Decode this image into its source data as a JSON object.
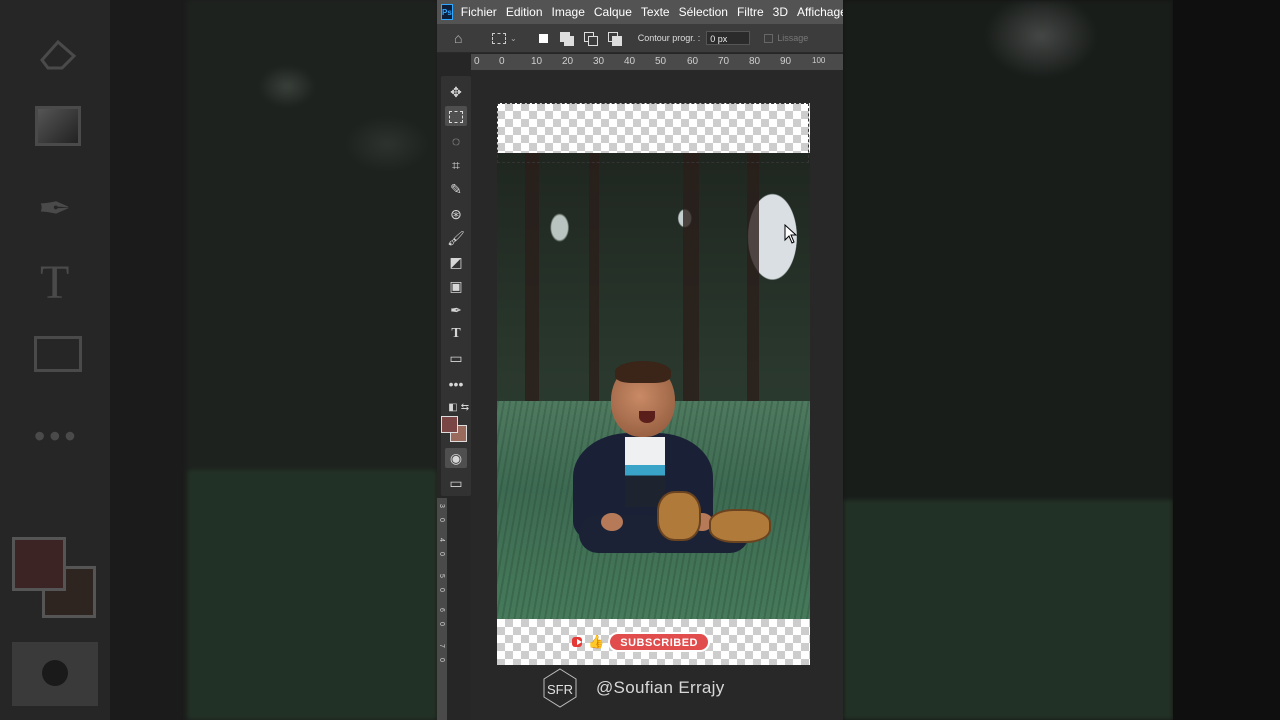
{
  "app": {
    "logo": "Ps",
    "menu": [
      "Fichier",
      "Edition",
      "Image",
      "Calque",
      "Texte",
      "Sélection",
      "Filtre",
      "3D",
      "Affichage"
    ]
  },
  "options_bar": {
    "feather_label": "Contour progr. :",
    "feather_value": "0 px",
    "antialias_label": "Lissage"
  },
  "ruler": {
    "top_ticks": [
      "0",
      "0",
      "10",
      "20",
      "30",
      "40",
      "50",
      "60",
      "70",
      "80",
      "90",
      "100"
    ],
    "left_ticks": [
      "3",
      "0",
      "4",
      "0",
      "5",
      "0",
      "6",
      "0",
      "7",
      "0"
    ]
  },
  "toolbar": {
    "tools": [
      "move-tool",
      "marquee-tool",
      "quick-select-tool",
      "crop-tool",
      "eyedropper-tool",
      "spot-heal-tool",
      "brush-tool",
      "eraser-tool",
      "gradient-tool",
      "pen-tool",
      "type-tool",
      "rectangle-tool",
      "more-tools"
    ],
    "active_tool": "marquee-tool",
    "foreground_color": "#7a4645",
    "background_color": "#9a6a5c"
  },
  "overlay": {
    "subscribe_label": "SUBSCRIBED",
    "watermark_handle": "@Soufian Errajy",
    "watermark_logo": "SFR"
  },
  "colors": {
    "menubar": "#535353",
    "options": "#3c3c3c",
    "canvas": "#282828",
    "subscribe": "#e14c4c"
  }
}
